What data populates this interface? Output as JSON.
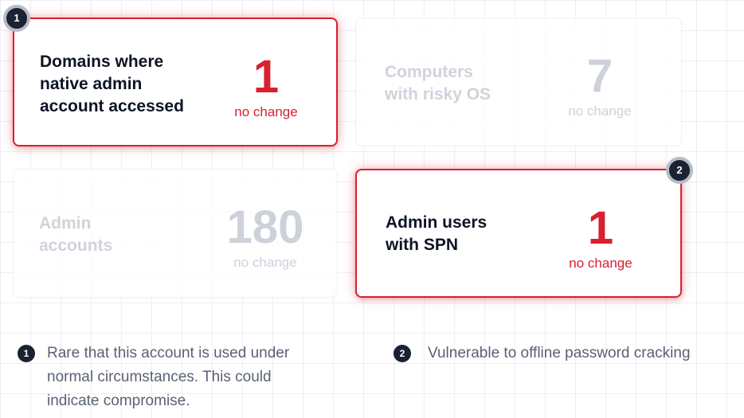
{
  "cards": [
    {
      "label_lines": [
        "Domains where",
        "native admin",
        "account accessed"
      ],
      "value": "1",
      "change": "no change",
      "badge": "1",
      "state": "highlighted"
    },
    {
      "label_lines": [
        "Computers",
        "with risky OS"
      ],
      "value": "7",
      "change": "no change",
      "state": "faded"
    },
    {
      "label_lines": [
        "Admin",
        "accounts"
      ],
      "value": "180",
      "change": "no change",
      "state": "faded"
    },
    {
      "label_lines": [
        "Admin users",
        "with SPN"
      ],
      "value": "1",
      "change": "no change",
      "badge": "2",
      "state": "highlighted"
    }
  ],
  "notes": [
    {
      "number": "1",
      "lines": [
        "Rare that this account is used under",
        "normal circumstances. This could",
        "indicate compromise."
      ]
    },
    {
      "number": "2",
      "lines": [
        "Vulnerable to offline password cracking"
      ]
    }
  ],
  "colors": {
    "accent_red": "#d8202f",
    "badge_dark": "#1b2233",
    "faded_text": "#cfd3dc",
    "note_text": "#5a6173"
  }
}
